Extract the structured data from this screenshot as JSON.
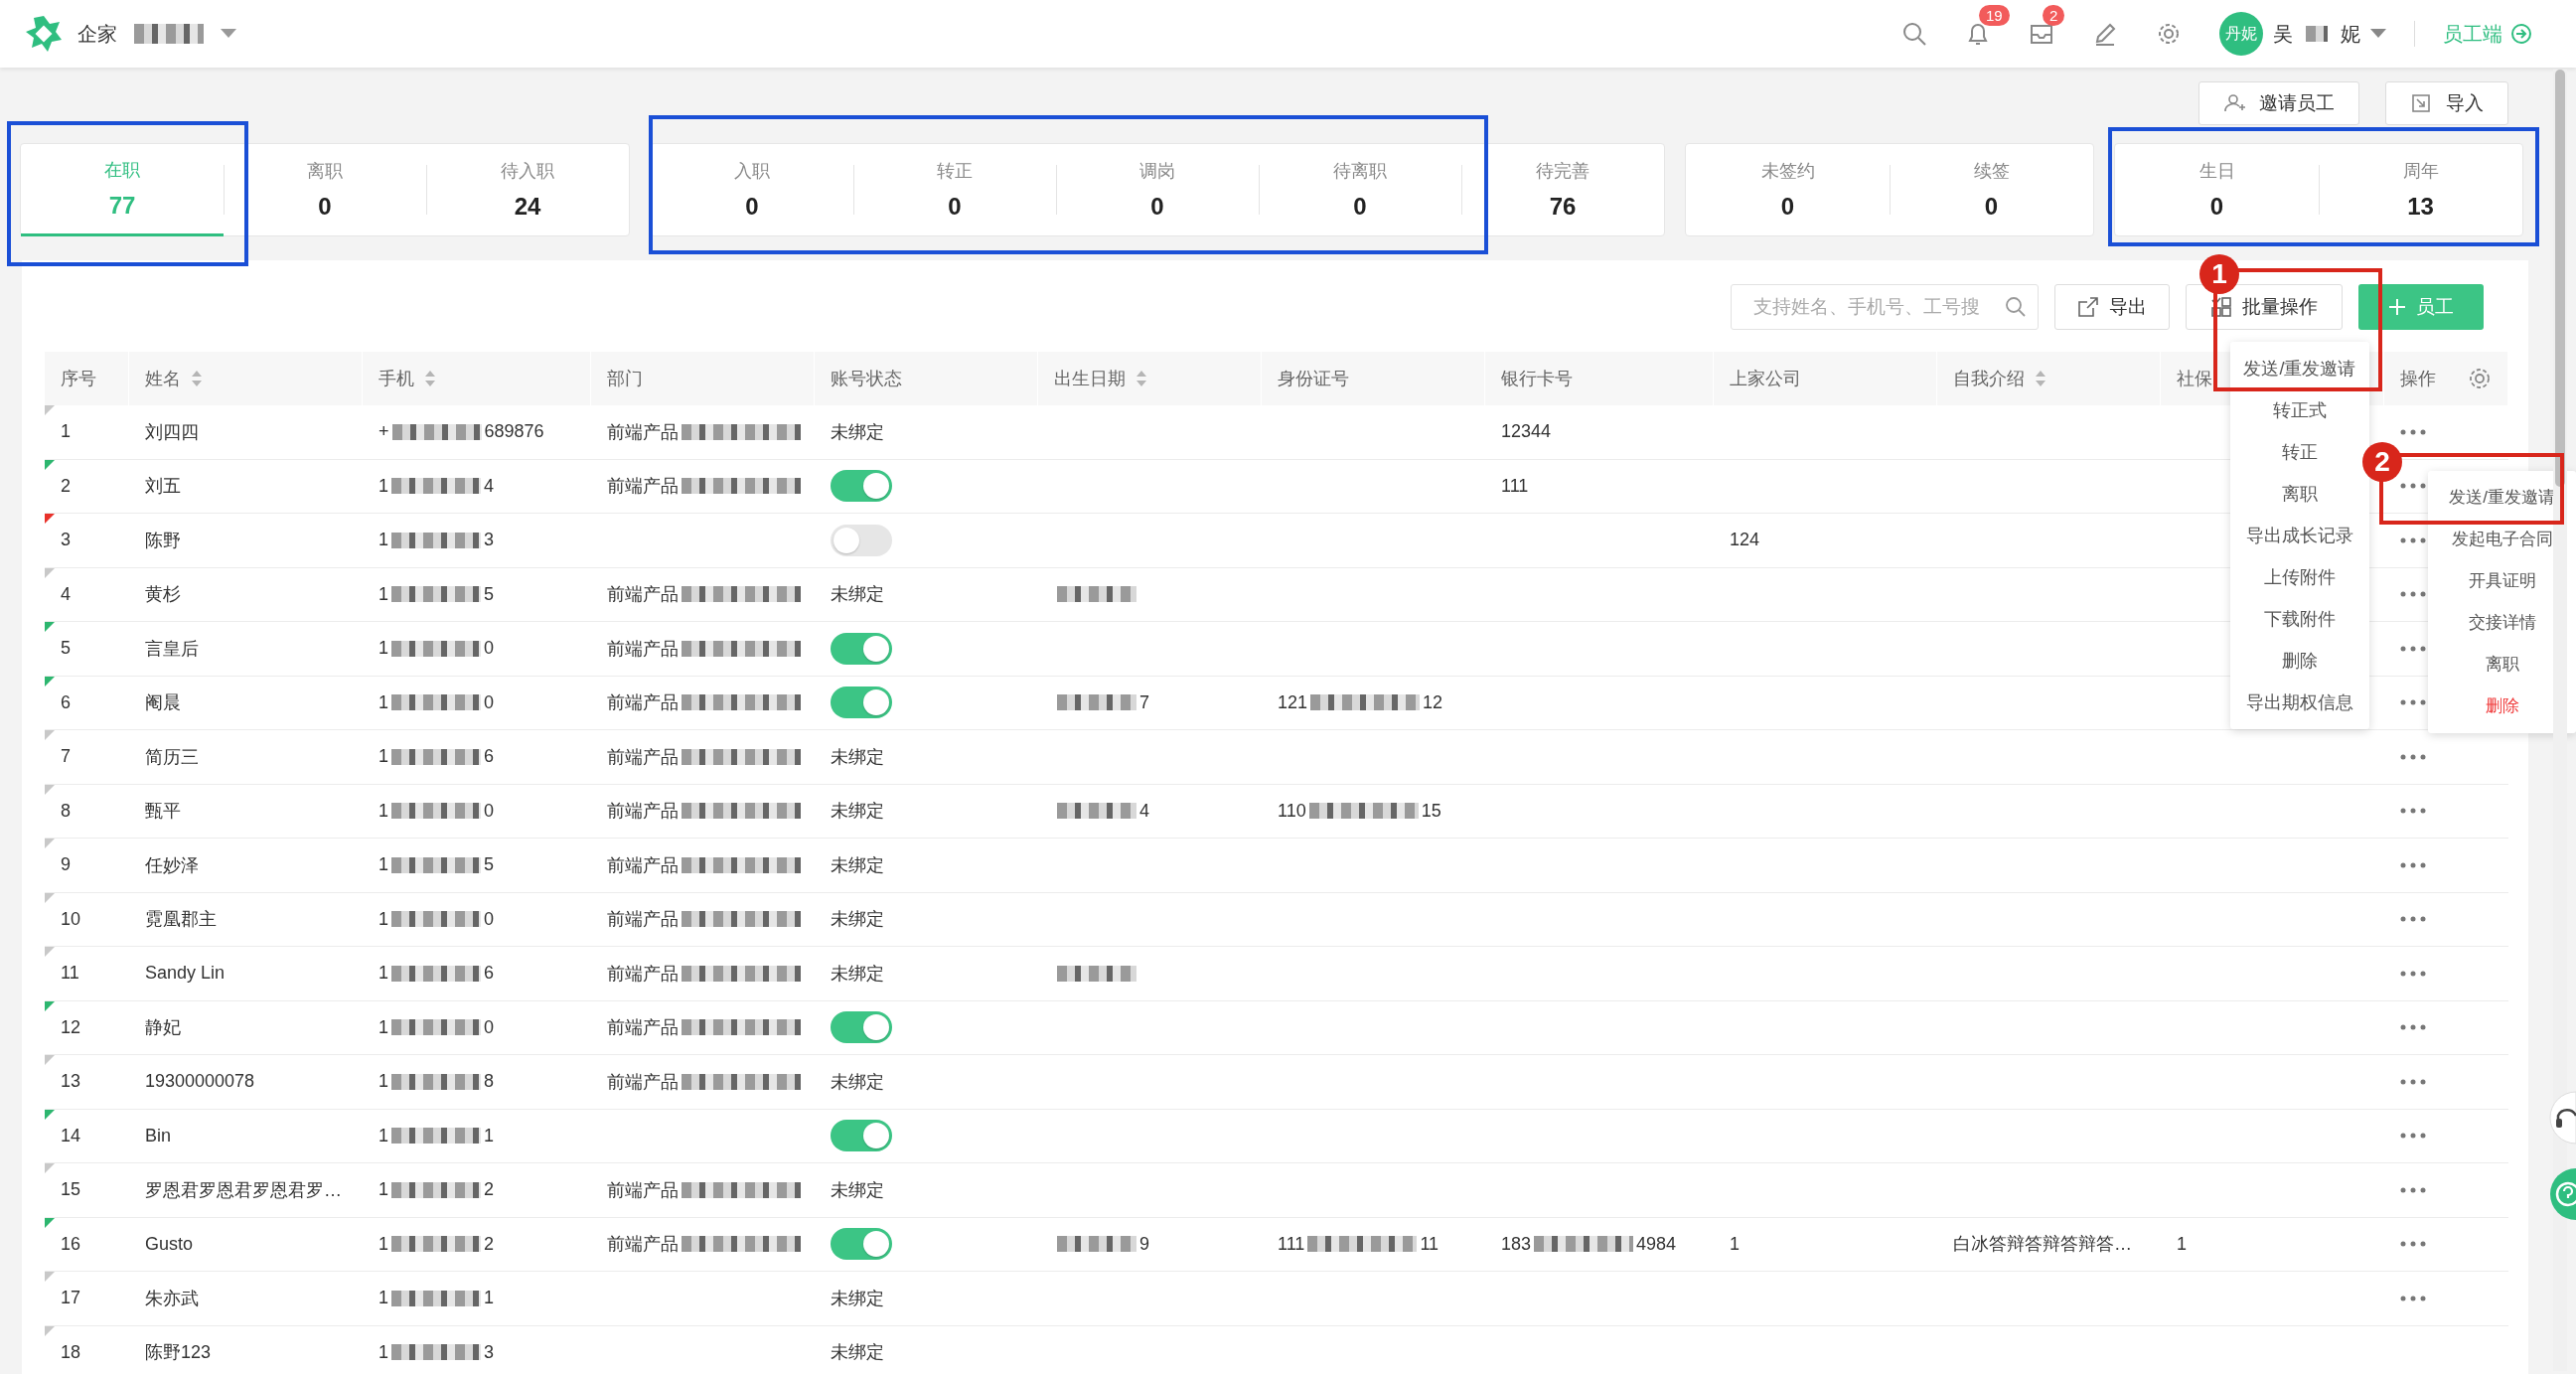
{
  "topbar": {
    "company": {
      "start": "企家"
    },
    "badges": {
      "notifications": "19",
      "messages": "2"
    },
    "avatar": "丹妮",
    "user": {
      "start": "吴",
      "end": "妮"
    },
    "portal_link": "员工端"
  },
  "actions": [
    "邀请员工",
    "导入"
  ],
  "stat_groups": [
    {
      "items": [
        {
          "label": "在职",
          "value": "77",
          "selected": true
        },
        {
          "label": "离职",
          "value": "0",
          "selected": false
        },
        {
          "label": "待入职",
          "value": "24",
          "selected": false
        }
      ]
    },
    {
      "items": [
        {
          "label": "入职",
          "value": "0",
          "selected": false
        },
        {
          "label": "转正",
          "value": "0",
          "selected": false
        },
        {
          "label": "调岗",
          "value": "0",
          "selected": false
        },
        {
          "label": "待离职",
          "value": "0",
          "selected": false
        },
        {
          "label": "待完善",
          "value": "76",
          "selected": false
        }
      ]
    },
    {
      "items": [
        {
          "label": "未签约",
          "value": "0",
          "selected": false
        },
        {
          "label": "续签",
          "value": "0",
          "selected": false
        }
      ]
    },
    {
      "items": [
        {
          "label": "生日",
          "value": "0",
          "selected": false
        },
        {
          "label": "周年",
          "value": "13",
          "selected": false
        }
      ]
    }
  ],
  "toolbar": {
    "search": {
      "placeholder": "支持姓名、手机号、工号搜"
    },
    "export": "导出",
    "batch": "批量操作",
    "add": "员工"
  },
  "table": {
    "columns": [
      {
        "label": "序号",
        "sortable": false
      },
      {
        "label": "姓名",
        "sortable": true
      },
      {
        "label": "手机",
        "sortable": true
      },
      {
        "label": "部门",
        "sortable": false
      },
      {
        "label": "账号状态",
        "sortable": false
      },
      {
        "label": "出生日期",
        "sortable": true
      },
      {
        "label": "身份证号",
        "sortable": false
      },
      {
        "label": "银行卡号",
        "sortable": false
      },
      {
        "label": "上家公司",
        "sortable": false
      },
      {
        "label": "自我介绍",
        "sortable": true
      },
      {
        "label": "社保",
        "sortable": false
      },
      {
        "label": "操作",
        "sortable": false
      }
    ],
    "rows": [
      {
        "no": "1",
        "name": "刘四四",
        "phone": {
          "start": "+",
          "end": "689876"
        },
        "dept": {
          "start": "前端产品"
        },
        "account": {
          "kind": "text",
          "text": "未绑定"
        },
        "bank": "12344",
        "color": "#c8c8c8",
        "has_actions": true
      },
      {
        "no": "2",
        "name": "刘五",
        "phone": {
          "start": "1",
          "end": "4"
        },
        "dept": {
          "start": "前端产品"
        },
        "account": {
          "kind": "toggle",
          "on": true
        },
        "bank": "111",
        "color": "#2db66f",
        "has_actions": true
      },
      {
        "no": "3",
        "name": "陈野",
        "phone": {
          "start": "1",
          "end": "3"
        },
        "account": {
          "kind": "toggle",
          "on": false
        },
        "company": "124",
        "color": "#e8312a",
        "has_actions": true
      },
      {
        "no": "4",
        "name": "黄杉",
        "phone": {
          "start": "1",
          "end": "5"
        },
        "dept": {
          "start": "前端产品"
        },
        "account": {
          "kind": "text",
          "text": "未绑定"
        },
        "birth": {
          "redacted": true
        },
        "color": "#c8c8c8",
        "has_actions": true
      },
      {
        "no": "5",
        "name": "言皇后",
        "phone": {
          "start": "1",
          "end": "0"
        },
        "dept": {
          "start": "前端产品"
        },
        "account": {
          "kind": "toggle",
          "on": true
        },
        "color": "#2db66f",
        "has_actions": true
      },
      {
        "no": "6",
        "name": "阉晨",
        "phone": {
          "start": "1",
          "end": "0"
        },
        "dept": {
          "start": "前端产品"
        },
        "account": {
          "kind": "toggle",
          "on": true
        },
        "birth": {
          "end": "7"
        },
        "idno": {
          "start": "121",
          "end": "12"
        },
        "color": "#2db66f",
        "has_actions": true
      },
      {
        "no": "7",
        "name": "简历三",
        "phone": {
          "start": "1",
          "end": "6"
        },
        "dept": {
          "start": "前端产品"
        },
        "account": {
          "kind": "text",
          "text": "未绑定"
        },
        "color": "#c8c8c8",
        "has_actions": true
      },
      {
        "no": "8",
        "name": "甄平",
        "phone": {
          "start": "1",
          "end": "0"
        },
        "dept": {
          "start": "前端产品"
        },
        "account": {
          "kind": "text",
          "text": "未绑定"
        },
        "birth": {
          "end": "4"
        },
        "idno": {
          "start": "110",
          "end": "15"
        },
        "color": "#c8c8c8",
        "has_actions": true
      },
      {
        "no": "9",
        "name": "任妙泽",
        "phone": {
          "start": "1",
          "end": "5"
        },
        "dept": {
          "start": "前端产品"
        },
        "account": {
          "kind": "text",
          "text": "未绑定"
        },
        "color": "#c8c8c8",
        "has_actions": true
      },
      {
        "no": "10",
        "name": "霓凰郡主",
        "phone": {
          "start": "1",
          "end": "0"
        },
        "dept": {
          "start": "前端产品"
        },
        "account": {
          "kind": "text",
          "text": "未绑定"
        },
        "color": "#c8c8c8",
        "has_actions": true
      },
      {
        "no": "11",
        "name": "Sandy Lin",
        "phone": {
          "start": "1",
          "end": "6"
        },
        "dept": {
          "start": "前端产品"
        },
        "account": {
          "kind": "text",
          "text": "未绑定"
        },
        "birth": {
          "redacted": true
        },
        "color": "#c8c8c8",
        "has_actions": true
      },
      {
        "no": "12",
        "name": "静妃",
        "phone": {
          "start": "1",
          "end": "0"
        },
        "dept": {
          "start": "前端产品"
        },
        "account": {
          "kind": "toggle",
          "on": true
        },
        "color": "#2db66f",
        "has_actions": true
      },
      {
        "no": "13",
        "name": "19300000078",
        "phone": {
          "start": "1",
          "end": "8"
        },
        "dept": {
          "start": "前端产品"
        },
        "account": {
          "kind": "text",
          "text": "未绑定"
        },
        "color": "#c8c8c8",
        "has_actions": true
      },
      {
        "no": "14",
        "name": "Bin",
        "phone": {
          "start": "1",
          "end": "1"
        },
        "account": {
          "kind": "toggle",
          "on": true
        },
        "color": "#2db66f",
        "has_actions": true
      },
      {
        "no": "15",
        "name": "罗恩君罗恩君罗恩君罗…",
        "phone": {
          "start": "1",
          "end": "2"
        },
        "dept": {
          "start": "前端产品"
        },
        "account": {
          "kind": "text",
          "text": "未绑定"
        },
        "color": "#c8c8c8",
        "has_actions": true
      },
      {
        "no": "16",
        "name": "Gusto",
        "phone": {
          "start": "1",
          "end": "2"
        },
        "dept": {
          "start": "前端产品"
        },
        "account": {
          "kind": "toggle",
          "on": true
        },
        "birth": {
          "end": "9"
        },
        "idno": {
          "start": "111",
          "end": "11"
        },
        "bank": {
          "start": "183",
          "end": "4984"
        },
        "company": "1",
        "intro": "白冰答辩答辩答辩答…",
        "social": "1",
        "color": "#2db66f",
        "has_actions": true
      },
      {
        "no": "17",
        "name": "朱亦武",
        "phone": {
          "start": "1",
          "end": "1"
        },
        "account": {
          "kind": "text",
          "text": "未绑定"
        },
        "color": "#c8c8c8",
        "has_actions": true
      },
      {
        "no": "18",
        "name": "陈野123",
        "phone": {
          "start": "1",
          "end": "3"
        },
        "account": {
          "kind": "text",
          "text": "未绑定"
        },
        "color": "#c8c8c8",
        "has_actions": false
      }
    ]
  },
  "batch_menu": [
    {
      "label": "发送/重发邀请",
      "danger": false
    },
    {
      "label": "转正式",
      "danger": false
    },
    {
      "label": "转正",
      "danger": false
    },
    {
      "label": "离职",
      "danger": false
    },
    {
      "label": "导出成长记录",
      "danger": false
    },
    {
      "label": "上传附件",
      "danger": false
    },
    {
      "label": "下载附件",
      "danger": false
    },
    {
      "label": "删除",
      "danger": false
    },
    {
      "label": "导出期权信息",
      "danger": false
    }
  ],
  "row_menu": [
    {
      "label": "发送/重发邀请",
      "danger": false
    },
    {
      "label": "发起电子合同",
      "danger": false
    },
    {
      "label": "开具证明",
      "danger": false
    },
    {
      "label": "交接详情",
      "danger": false
    },
    {
      "label": "离职",
      "danger": false
    },
    {
      "label": "删除",
      "danger": true
    }
  ],
  "annotations": [
    {
      "kind": "frame",
      "color": "#1a4fd6"
    },
    {
      "kind": "frame",
      "color": "#1a4fd6"
    },
    {
      "kind": "frame",
      "color": "#1a4fd6"
    },
    {
      "kind": "marker",
      "color": "#d8261b",
      "number": "1"
    },
    {
      "kind": "marker",
      "color": "#d8261b",
      "number": "2"
    }
  ]
}
